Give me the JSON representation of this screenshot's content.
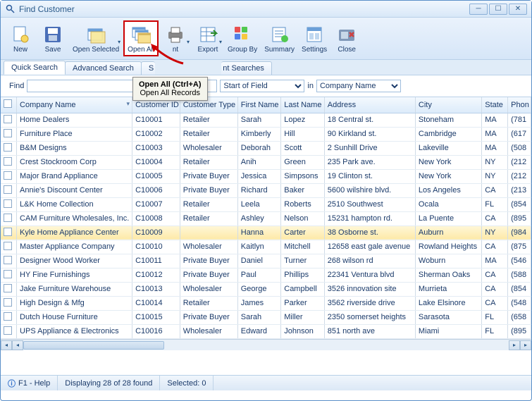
{
  "window": {
    "title": "Find Customer"
  },
  "toolbar": {
    "new": "New",
    "save": "Save",
    "open_selected": "Open Selected",
    "open_all": "Open All",
    "print": "nt",
    "export": "Export",
    "group_by": "Group By",
    "summary": "Summary",
    "settings": "Settings",
    "close": "Close"
  },
  "tooltip": {
    "title": "Open All (Ctrl+A)",
    "body": "Open All Records"
  },
  "tabs": {
    "quick": "Quick Search",
    "advanced": "Advanced Search",
    "s_prefix": "S",
    "nt_suffix": "nt Searches"
  },
  "find": {
    "label": "Find",
    "value": "",
    "match_label_partial": "Start of Field",
    "in_label": "in",
    "field": "Company Name"
  },
  "columns": {
    "company": "Company Name",
    "cid": "Customer ID",
    "ctype": "Customer Type",
    "fname": "First Name",
    "lname": "Last Name",
    "addr": "Address",
    "city": "City",
    "state": "State",
    "phone": "Phon"
  },
  "rows": [
    {
      "company": "Home Dealers",
      "cid": "C10001",
      "ctype": "Retailer",
      "fname": "Sarah",
      "lname": "Lopez",
      "addr": "18 Central st.",
      "city": "Stoneham",
      "state": "MA",
      "phone": "(781"
    },
    {
      "company": "Furniture Place",
      "cid": "C10002",
      "ctype": "Retailer",
      "fname": "Kimberly",
      "lname": "Hill",
      "addr": "90 Kirkland st.",
      "city": "Cambridge",
      "state": "MA",
      "phone": "(617"
    },
    {
      "company": "B&M Designs",
      "cid": "C10003",
      "ctype": "Wholesaler",
      "fname": "Deborah",
      "lname": "Scott",
      "addr": "2 Sunhill Drive",
      "city": "Lakeville",
      "state": "MA",
      "phone": "(508"
    },
    {
      "company": "Crest Stockroom Corp",
      "cid": "C10004",
      "ctype": "Retailer",
      "fname": "Anih",
      "lname": "Green",
      "addr": "235 Park ave.",
      "city": "New York",
      "state": "NY",
      "phone": "(212"
    },
    {
      "company": "Major Brand Appliance",
      "cid": "C10005",
      "ctype": "Private Buyer",
      "fname": "Jessica",
      "lname": "Simpsons",
      "addr": "19 Clinton st.",
      "city": "New York",
      "state": "NY",
      "phone": "(212"
    },
    {
      "company": "Annie's Discount Center",
      "cid": "C10006",
      "ctype": "Private Buyer",
      "fname": "Richard",
      "lname": "Baker",
      "addr": "5600 wilshire blvd.",
      "city": "Los Angeles",
      "state": "CA",
      "phone": "(213"
    },
    {
      "company": "L&K Home Collection",
      "cid": "C10007",
      "ctype": "Retailer",
      "fname": "Leela",
      "lname": "Roberts",
      "addr": "2510 Southwest",
      "city": "Ocala",
      "state": "FL",
      "phone": "(854"
    },
    {
      "company": "CAM Furniture Wholesales, Inc.",
      "cid": "C10008",
      "ctype": "Retailer",
      "fname": "Ashley",
      "lname": "Nelson",
      "addr": "15231 hampton rd.",
      "city": "La Puente",
      "state": "CA",
      "phone": "(895"
    },
    {
      "company": "Kyle Home Appliance Center",
      "cid": "C10009",
      "ctype": "",
      "fname": "Hanna",
      "lname": "Carter",
      "addr": "38 Osborne st.",
      "city": "Auburn",
      "state": "NY",
      "phone": "(984"
    },
    {
      "company": "Master Appliance Company",
      "cid": "C10010",
      "ctype": "Wholesaler",
      "fname": "Kaitlyn",
      "lname": "Mitchell",
      "addr": "12658 east gale avenue",
      "city": "Rowland Heights",
      "state": "CA",
      "phone": "(875"
    },
    {
      "company": "Designer Wood Worker",
      "cid": "C10011",
      "ctype": "Private Buyer",
      "fname": "Daniel",
      "lname": "Turner",
      "addr": "268 wilson rd",
      "city": "Woburn",
      "state": "MA",
      "phone": "(546"
    },
    {
      "company": "HY Fine Furnishings",
      "cid": "C10012",
      "ctype": "Private Buyer",
      "fname": "Paul",
      "lname": "Phillips",
      "addr": "22341 Ventura blvd",
      "city": "Sherman Oaks",
      "state": "CA",
      "phone": "(588"
    },
    {
      "company": "Jake Furniture Warehouse",
      "cid": "C10013",
      "ctype": "Wholesaler",
      "fname": "George",
      "lname": "Campbell",
      "addr": "3526 innovation site",
      "city": "Murrieta",
      "state": "CA",
      "phone": "(854"
    },
    {
      "company": "High Design & Mfg",
      "cid": "C10014",
      "ctype": "Retailer",
      "fname": "James",
      "lname": "Parker",
      "addr": "3562 riverside drive",
      "city": "Lake Elsinore",
      "state": "CA",
      "phone": "(548"
    },
    {
      "company": "Dutch House Furniture",
      "cid": "C10015",
      "ctype": "Private Buyer",
      "fname": "Sarah",
      "lname": "Miller",
      "addr": "2350 somerset heights",
      "city": "Sarasota",
      "state": "FL",
      "phone": "(658"
    },
    {
      "company": "UPS Appliance & Electronics",
      "cid": "C10016",
      "ctype": "Wholesaler",
      "fname": "Edward",
      "lname": "Johnson",
      "addr": "851 north ave",
      "city": "Miami",
      "state": "FL",
      "phone": "(895"
    }
  ],
  "status": {
    "help": "F1 - Help",
    "count": "Displaying 28 of 28 found",
    "selected": "Selected: 0"
  },
  "selected_row_index": 8
}
